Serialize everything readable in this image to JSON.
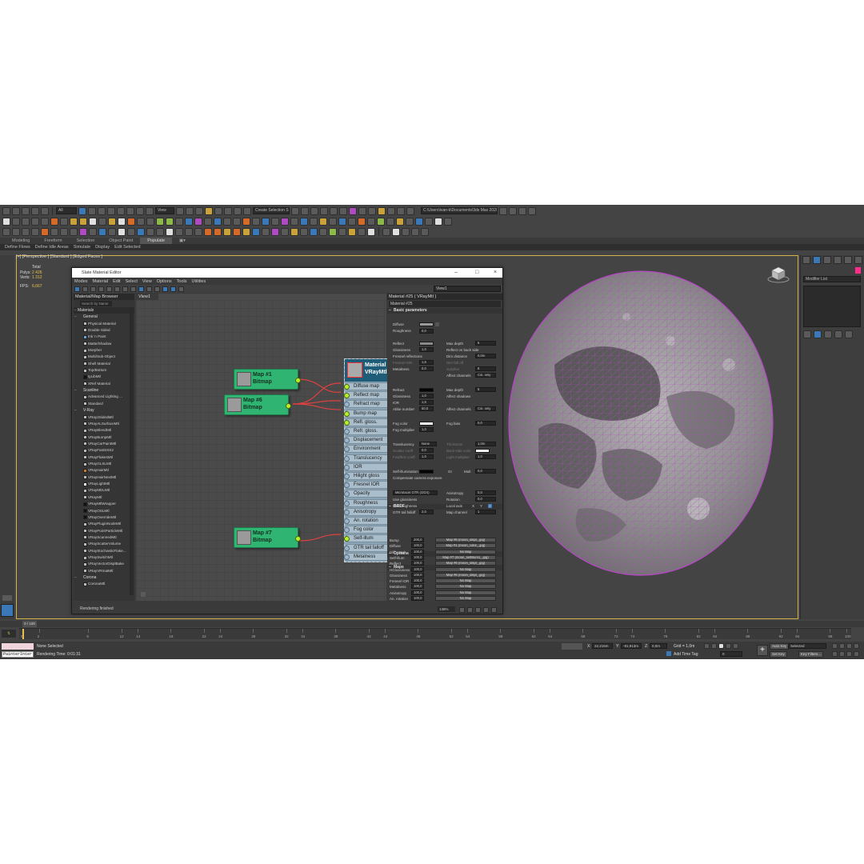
{
  "toolbar": {
    "workspace_drop": "All",
    "view_drop": "View",
    "selection_set": "Create Selection Se",
    "project_path": "C:\\Users\\ivan-k\\Documents\\3ds Max 2020"
  },
  "ribbon": {
    "tabs": [
      "Modeling",
      "Freeform",
      "Selection",
      "Object Paint",
      "Populate"
    ],
    "active_tab": "Populate",
    "subitems": [
      "Define Flows",
      "Define Idle Areas",
      "Simulate",
      "Display",
      "Edit Selected"
    ]
  },
  "viewport": {
    "label": "[+] [Perspective ] [Standard ] [Edged Faces ]",
    "stats": {
      "total_label": "Total",
      "polys_label": "Polys:",
      "polys_value": "2 426",
      "verts_label": "Verts:",
      "verts_value": "1 312",
      "fps_label": "FPS:",
      "fps_value": "6,667"
    }
  },
  "command_panel": {
    "modifier_list": "Modifier List",
    "swatch_color": "#ff2d8a"
  },
  "slate": {
    "title": "Slate Material Editor",
    "menu": [
      "Modes",
      "Material",
      "Edit",
      "Select",
      "View",
      "Options",
      "Tools",
      "Utilities"
    ],
    "view_dropdown": "View1",
    "browser": {
      "title": "Material/Map Browser",
      "search_placeholder": "Search by Name ...",
      "root": "Materials",
      "groups": [
        {
          "name": "General",
          "items": [
            "Physical Material",
            "Double Sided",
            "Ink 'n Paint",
            "Matte/Shadow",
            "Morpher",
            "Multi/Sub-Object",
            "Shell Material",
            "Top/Bottom",
            "tyLibMtl",
            "XRef Material"
          ]
        },
        {
          "name": "Scanline",
          "items": [
            "Advanced Lighting ...",
            "Standard"
          ]
        },
        {
          "name": "V-Ray",
          "items": [
            "VRay2SidedMtl",
            "VRayALSurfaceMtl",
            "VRayBlendMtl",
            "VRayBumpMtl",
            "VRayCarPaintMtl",
            "VRayFastSSS2",
            "VRayFlakesMtl",
            "VRayGLSLMtl",
            "VRayHairMtl",
            "VRayHairNextMtl",
            "VRayLightMtl",
            "VRayMDLMtl",
            "VRayMtl",
            "VRayMtlWrapper",
            "VRayOSLMtl",
            "VRayOverrideMtl",
            "VRayPluginNodeMtl",
            "VRayPointParticleMtl",
            "VRayScannedMtl",
            "VRayScatterVolume",
            "VRayStochasticFlake...",
            "VRaySwitchMtl",
            "VRayVectorDisplBake",
            "VRayVRmatMtl"
          ]
        },
        {
          "name": "Corona",
          "items": [
            "CoronaMtl"
          ]
        }
      ]
    },
    "view_tab": "View1",
    "nodes": {
      "map1": {
        "line1": "Map #1",
        "line2": "Bitmap"
      },
      "map6": {
        "line1": "Map #6",
        "line2": "Bitmap"
      },
      "map7": {
        "line1": "Map #7",
        "line2": "Bitmap"
      },
      "material": {
        "line1": "Material #25",
        "line2": "VRayMtl"
      }
    },
    "slots": [
      "Diffuse map",
      "Reflect map",
      "Refract map",
      "Bump map",
      "Refl. gloss.",
      "Refr. gloss.",
      "Displacement",
      "Environment",
      "Translucency",
      "IOR",
      "Hilight gloss",
      "Fresnel IOR",
      "Opacity",
      "Roughness",
      "Anisotropy",
      "An. rotation",
      "Fog color",
      "Self-illum",
      "GTR tail falloff",
      "Metalness"
    ],
    "params": {
      "title": "Material #25  ( VRayMtl )",
      "name": "Material #25",
      "basic": "Basic parameters",
      "diffuse": "Diffuse",
      "roughness": "Roughness",
      "roughness_val": "0,0",
      "reflect": "Reflect",
      "max_depth": "Max depth",
      "max_depth_val": "5",
      "glossiness": "Glossiness",
      "gloss_val": "1,0",
      "reflect_back": "Reflect on back side",
      "fresnel": "Fresnel reflections",
      "dim_distance": "Dim distance",
      "dim_val": "0,0m",
      "fresnel_ior": "Fresnel IOR",
      "fresnel_ior_val": "1,6",
      "dim_falloff": "Dim fall off",
      "metalness": "Metalness",
      "metal_val": "0,0",
      "subdivs": "Subdivs",
      "subdivs_val": "8",
      "affect_channels": "Affect channels",
      "col_only": "Col. only",
      "refract": "Refract",
      "refr_max_val": "5",
      "refr_gloss_val": "1,0",
      "affect_shadows": "Affect shadows",
      "ior": "IOR",
      "ior_val": "1,6",
      "abbe": "Abbe number",
      "abbe_val": "50,0",
      "fog_color": "Fog color",
      "fog_bias": "Fog bias",
      "fog_bias_val": "0,0",
      "fog_mult": "Fog multiplier",
      "fog_mult_val": "1,0",
      "translucency": "Translucency",
      "transl_val": "None",
      "thickness": "Thickness",
      "thickness_val": "1,0m",
      "scatter_coeff": "Scatter coeff",
      "scatter_val": "0,0",
      "back_side_color": "Back-side color",
      "fwd_bck": "Fwd/bck coeff",
      "fwd_val": "1,0",
      "light_mult": "Light multiplier",
      "light_mult_val": "1,0",
      "self_illum": "Self-illumination",
      "gi": "GI",
      "mult": "Mult",
      "mult_val": "0,0",
      "comp_cam": "Compensate camera exposure",
      "brdf": "BRDF",
      "brdf_type": "Microfacet GTR (GGX)",
      "anisotropy": "Anisotropy",
      "aniso_val": "0,0",
      "use_gloss": "Use glossiness",
      "rotation": "Rotation",
      "rotation_val": "0,0",
      "use_rough": "Use roughness",
      "local_axis": "Local axis",
      "axis_x": "X",
      "axis_y": "Y",
      "axis_z": "Z",
      "gtr_tail": "GTR tail falloff",
      "gtr_val": "2,0",
      "map_channel": "Map channel",
      "map_channel_val": "1",
      "options": "Options",
      "maps": "Maps",
      "map_rows": [
        {
          "name": "Bump",
          "amount": "200,0",
          "map": "Map #6 (moon_displ_.jpg)"
        },
        {
          "name": "Diffuse",
          "amount": "100,0",
          "map": "Map #1 (moon_color_.jpg)"
        },
        {
          "name": "Diff. rough.",
          "amount": "100,0",
          "map": "No Map"
        },
        {
          "name": "Self-illum",
          "amount": "100,0",
          "map": "Map #7 (moon_selfillum1_.jpg)"
        },
        {
          "name": "Reflect",
          "amount": "100,0",
          "map": "Map #6 (moon_displ_.jpg)"
        },
        {
          "name": "HGlossiness",
          "amount": "100,0",
          "map": "No Map"
        },
        {
          "name": "Glossiness",
          "amount": "100,0",
          "map": "Map #6 (moon_displ_.jpg)"
        },
        {
          "name": "Fresnel IOR",
          "amount": "100,0",
          "map": "No Map"
        },
        {
          "name": "Metalness",
          "amount": "100,0",
          "map": "No Map"
        },
        {
          "name": "Anisotropy",
          "amount": "100,0",
          "map": "No Map"
        },
        {
          "name": "An. rotation",
          "amount": "100,0",
          "map": "No Map"
        }
      ]
    },
    "status": "Rendering finished",
    "zoom": "138%"
  },
  "timeline": {
    "slider": "0 / 100",
    "ticks": [
      "0",
      "2",
      "8",
      "12",
      "14",
      "18",
      "22",
      "24",
      "28",
      "32",
      "34",
      "38",
      "42",
      "44",
      "48",
      "52",
      "54",
      "58",
      "62",
      "64",
      "68",
      "72",
      "74",
      "78",
      "82",
      "84",
      "88",
      "92",
      "94",
      "98",
      "100"
    ]
  },
  "statusbar": {
    "script_line1": "",
    "script_line2": "PainterInter",
    "selection": "None Selected",
    "render_time": "Rendering Time: 0:01:31",
    "x_label": "X:",
    "x_val": "22,215m",
    "y_label": "Y:",
    "y_val": "-91,913m",
    "z_label": "Z:",
    "z_val": "0,0m",
    "grid": "Grid = 1,0m",
    "add_time_tag": "Add Time Tag",
    "auto_key": "Auto Key",
    "set_key": "Set Key",
    "selected_drop": "Selected",
    "key_filters": "Key Filters...",
    "frame": "0"
  }
}
